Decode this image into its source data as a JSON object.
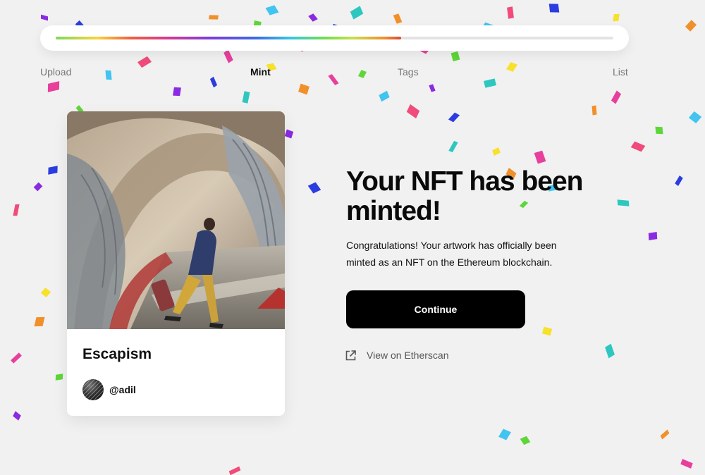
{
  "progress": {
    "fraction": 0.62,
    "steps": [
      {
        "label": "Upload",
        "active": false
      },
      {
        "label": "Mint",
        "active": true
      },
      {
        "label": "Tags",
        "active": false
      },
      {
        "label": "List",
        "active": false
      }
    ]
  },
  "nft_card": {
    "title": "Escapism",
    "creator_handle": "@adil"
  },
  "success": {
    "heading": "Your NFT has been minted!",
    "message": "Congratulations! Your artwork has officially been minted as an NFT on the Ethereum blockchain.",
    "continue_label": "Continue",
    "etherscan_label": "View on Etherscan",
    "etherscan_icon": "external-link-icon"
  },
  "colors": {
    "background": "#f1f1f1",
    "button": "#000000",
    "confetti": [
      "#8a2be2",
      "#2b3de0",
      "#2ec7c0",
      "#f7e12b",
      "#f1902b",
      "#e83f9c",
      "#5ed639",
      "#41c4f0",
      "#f04b7a"
    ]
  }
}
